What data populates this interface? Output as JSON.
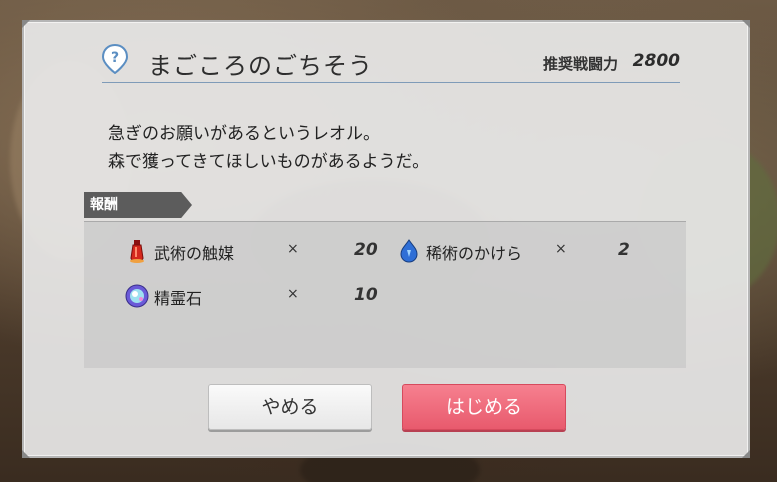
{
  "quest": {
    "title": "まごころのごちそう",
    "power_label": "推奨戦闘力",
    "power_value": "2800",
    "description": [
      "急ぎのお願いがあるというレオル。",
      "森で獲ってきてほしいものがあるようだ。"
    ]
  },
  "rewards": {
    "label": "報酬",
    "items": [
      {
        "name": "武術の触媒",
        "times": "×",
        "qty": "20",
        "icon": "red-catalyst-icon"
      },
      {
        "name": "稀術のかけら",
        "times": "×",
        "qty": "2",
        "icon": "blue-shard-icon"
      },
      {
        "name": "精霊石",
        "times": "×",
        "qty": "10",
        "icon": "spirit-stone-icon"
      }
    ]
  },
  "buttons": {
    "cancel": "やめる",
    "start": "はじめる"
  },
  "colors": {
    "accent_start": "#ec6477",
    "header_line": "#7f9bb8",
    "help_icon": "#5b8ec2"
  }
}
